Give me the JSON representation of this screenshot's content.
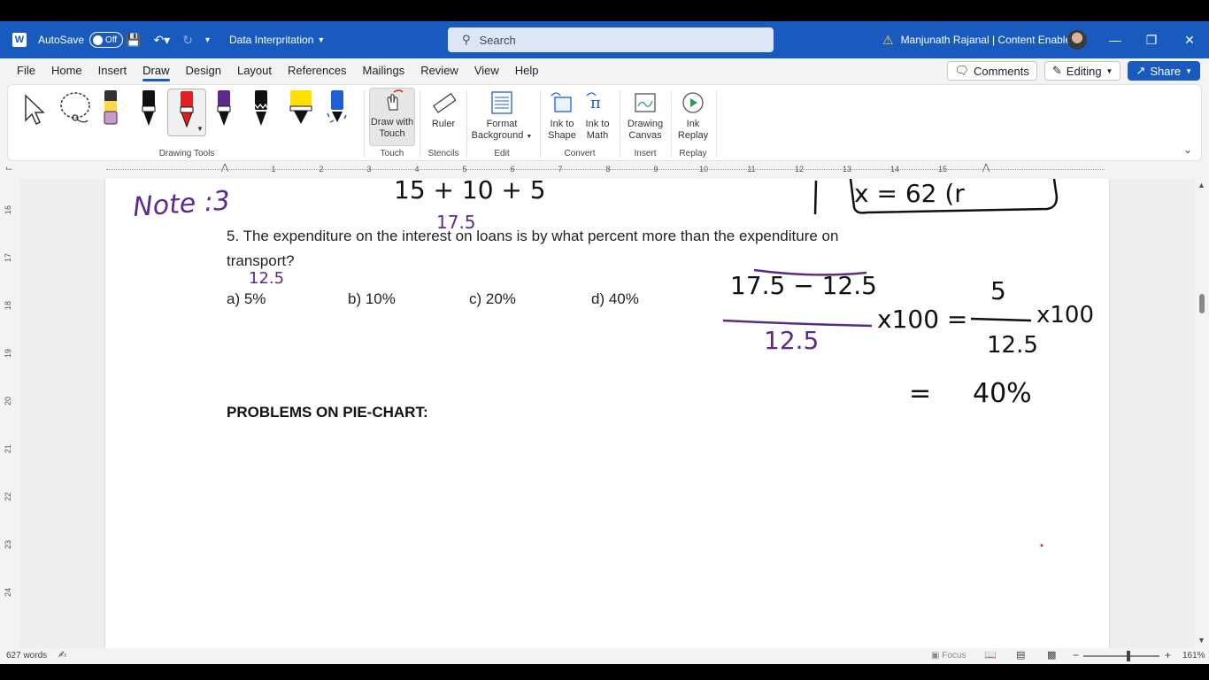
{
  "titlebar": {
    "autosave_label": "AutoSave",
    "autosave_state": "Off",
    "doc_title": "Data Interpritation",
    "search_placeholder": "Search",
    "user_name": "Manjunath Rajanal | Content Enablers"
  },
  "menu": {
    "tabs": [
      "File",
      "Home",
      "Insert",
      "Draw",
      "Design",
      "Layout",
      "References",
      "Mailings",
      "Review",
      "View",
      "Help"
    ],
    "active_tab": "Draw",
    "comments_label": "Comments",
    "editing_label": "Editing",
    "share_label": "Share"
  },
  "ribbon": {
    "drawing_tools_label": "Drawing Tools",
    "touch": {
      "button": "Draw with Touch",
      "group": "Touch"
    },
    "stencils": {
      "button": "Ruler",
      "group": "Stencils"
    },
    "edit": {
      "button": "Format Background",
      "group": "Edit"
    },
    "convert": {
      "ink_to_shape": "Ink to Shape",
      "ink_to_math": "Ink to Math",
      "group": "Convert"
    },
    "insert": {
      "button": "Drawing Canvas",
      "group": "Insert"
    },
    "replay": {
      "button": "Ink Replay",
      "group": "Replay"
    },
    "pen_colors": [
      "#000000",
      "#e02020",
      "#5b2a8a",
      "#000000",
      "#ffe000",
      "#1f5fd6"
    ],
    "highlighter_color": "#ffd84a"
  },
  "ruler": {
    "h_marks": [
      "1",
      "2",
      "3",
      "4",
      "5",
      "6",
      "7",
      "8",
      "9",
      "10",
      "11",
      "12",
      "13",
      "14",
      "15"
    ],
    "v_marks": [
      "16",
      "17",
      "18",
      "19",
      "20",
      "21",
      "22",
      "23",
      "24"
    ]
  },
  "document": {
    "question": "5. The expenditure on the interest on loans is by what percent more than the expenditure on transport?",
    "question_line1": "5. The expenditure on the interest on loans is by what percent more than the expenditure on",
    "question_line2": "transport?",
    "options": [
      "a) 5%",
      "b) 10%",
      "c) 20%",
      "d) 40%"
    ],
    "heading": "PROBLEMS ON PIE-CHART:",
    "ink": {
      "note": "Note :3",
      "sum": "15 + 10 + 5",
      "sum_result": "17.5",
      "box_text": "x = 62 (r",
      "transport_value": "12.5",
      "fraction_num": "17.5 − 12.5",
      "fraction_den": "12.5",
      "times100": "x100 =",
      "rhs_num": "5",
      "rhs_den": "12.5",
      "rhs_times": "x100",
      "equals": "=",
      "answer": "40%"
    },
    "ink_colors": {
      "black": "#111111",
      "purple": "#5b2a8a"
    }
  },
  "statusbar": {
    "word_count": "627 words",
    "focus_label": "Focus",
    "zoom": "161%"
  }
}
